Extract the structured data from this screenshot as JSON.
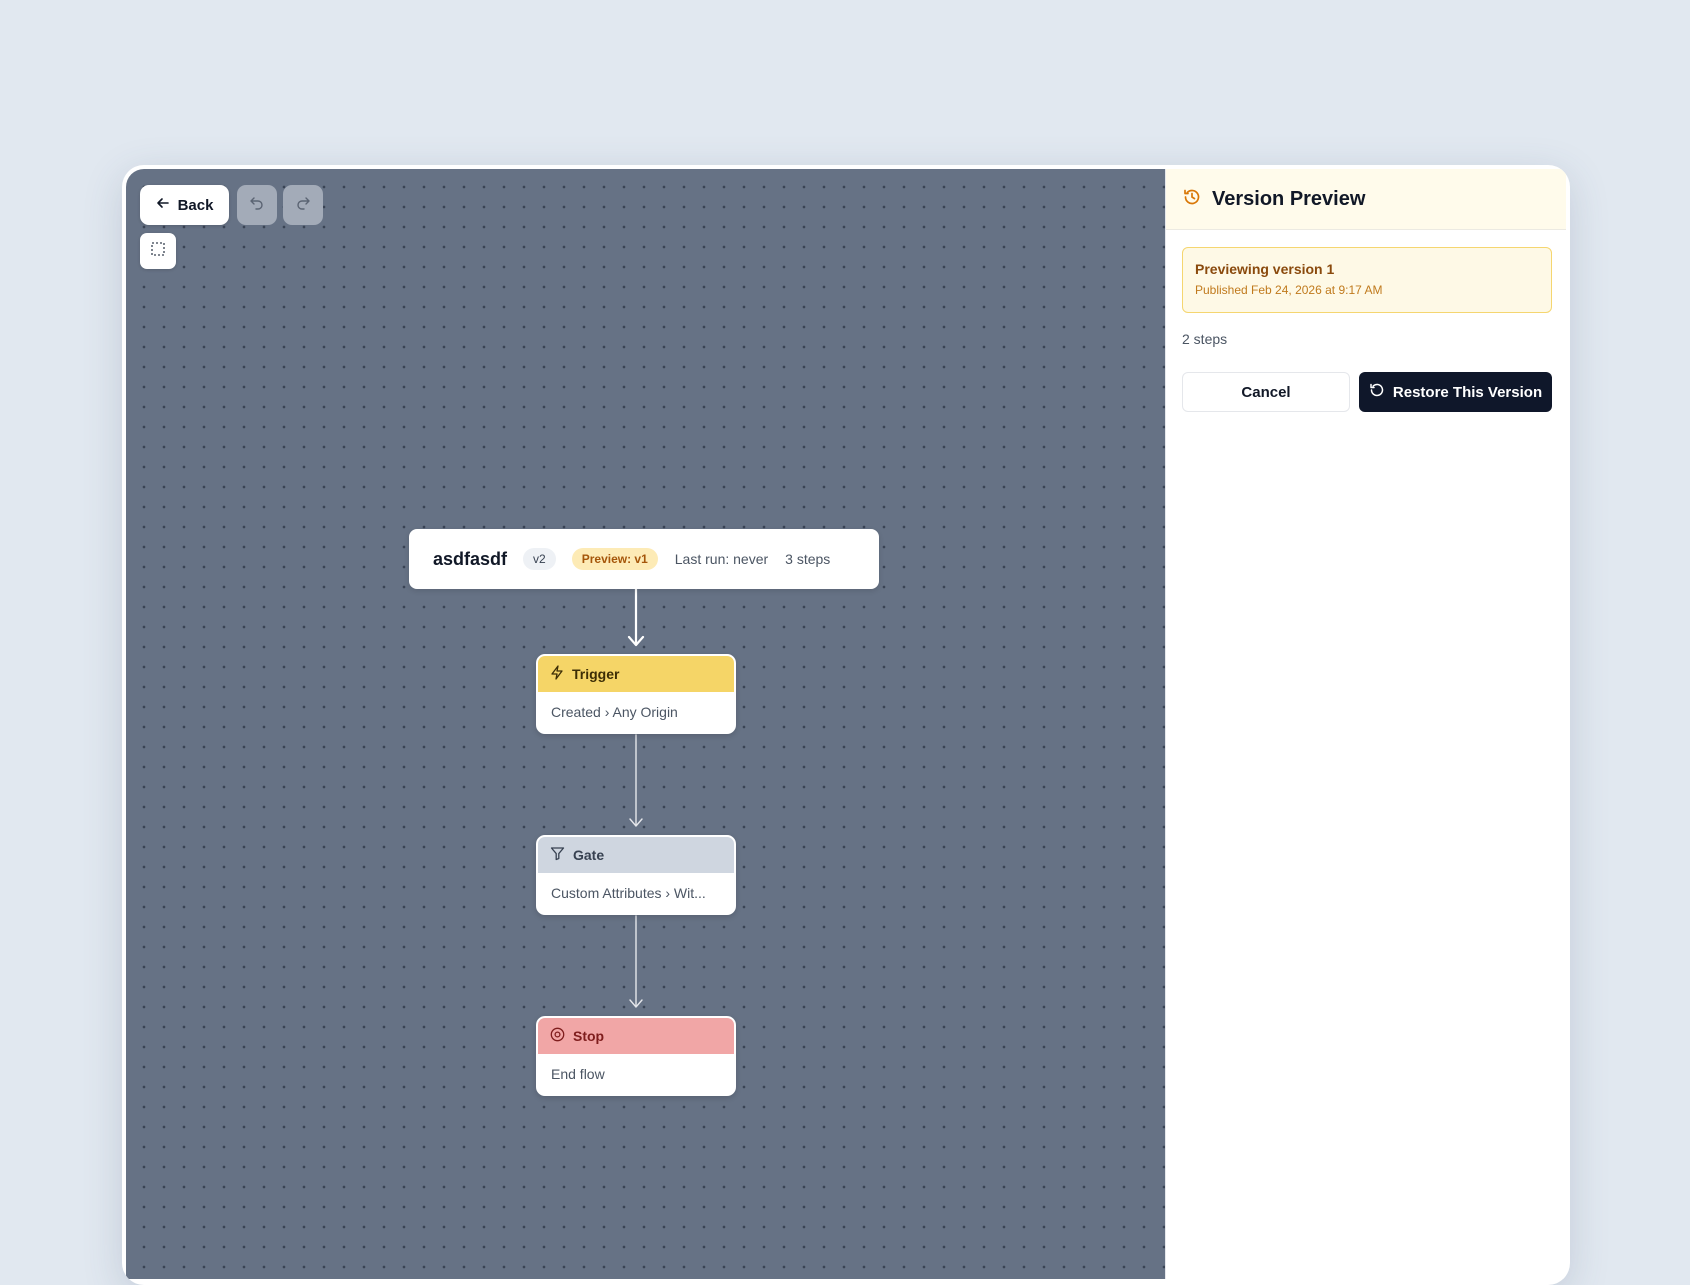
{
  "toolbar": {
    "back_label": "Back",
    "icons": {
      "back": "arrow-left-icon",
      "undo": "undo-icon",
      "redo": "redo-icon",
      "select": "selection-box-icon"
    }
  },
  "flow": {
    "name": "asdfasdf",
    "version_badge": "v2",
    "preview_badge": "Preview: v1",
    "last_run": "Last run: never",
    "steps_count": "3 steps"
  },
  "nodes": [
    {
      "type": "trigger",
      "title": "Trigger",
      "detail": "Created › Any Origin",
      "icon": "lightning-bolt-icon",
      "color": "#f5d567"
    },
    {
      "type": "gate",
      "title": "Gate",
      "detail": "Custom Attributes › Wit...",
      "icon": "filter-funnel-icon",
      "color": "#cfd6e0"
    },
    {
      "type": "stop",
      "title": "Stop",
      "detail": "End flow",
      "icon": "stop-circle-icon",
      "color": "#f1a6a6"
    }
  ],
  "panel": {
    "title": "Version Preview",
    "icon": "history-icon",
    "notice_title": "Previewing version 1",
    "notice_subtitle": "Published Feb 24, 2026 at 9:17 AM",
    "step_count": "2 steps",
    "cancel_label": "Cancel",
    "restore_label": "Restore This Version",
    "restore_icon": "rotate-ccw-icon"
  },
  "colors": {
    "canvas_bg": "#667285",
    "accent_dark": "#0f172a",
    "preview_badge_bg": "#fdebb6",
    "notice_border": "#f5d670"
  }
}
